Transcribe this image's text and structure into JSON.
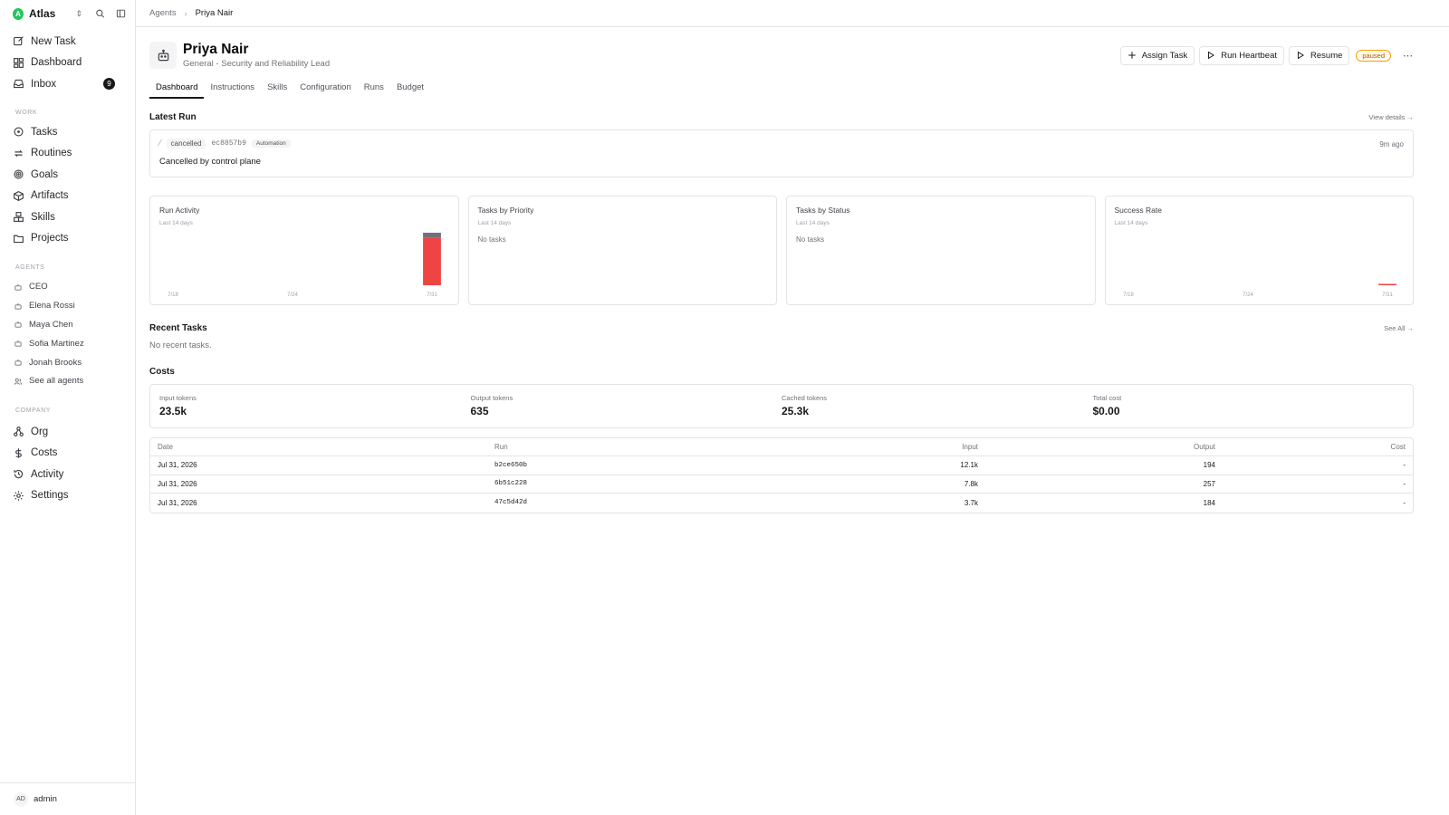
{
  "workspace": {
    "logo_letter": "A",
    "name": "Atlas"
  },
  "sidebar": {
    "top_items": [
      {
        "label": "New Task",
        "icon": "edit-icon"
      },
      {
        "label": "Dashboard",
        "icon": "dashboard-icon"
      },
      {
        "label": "Inbox",
        "icon": "inbox-icon",
        "badge": "9"
      }
    ],
    "work_label": "WORK",
    "work_items": [
      {
        "label": "Tasks",
        "icon": "circle-icon"
      },
      {
        "label": "Routines",
        "icon": "repeat-icon"
      },
      {
        "label": "Goals",
        "icon": "target-icon"
      },
      {
        "label": "Artifacts",
        "icon": "package-icon"
      },
      {
        "label": "Skills",
        "icon": "boxes-icon"
      },
      {
        "label": "Projects",
        "icon": "folder-icon"
      }
    ],
    "agents_label": "AGENTS",
    "agents": [
      {
        "label": "CEO"
      },
      {
        "label": "Elena Rossi"
      },
      {
        "label": "Maya Chen"
      },
      {
        "label": "Sofia Martinez"
      },
      {
        "label": "Jonah Brooks"
      }
    ],
    "see_all_agents": "See all agents",
    "company_label": "COMPANY",
    "company_items": [
      {
        "label": "Org",
        "icon": "org-icon"
      },
      {
        "label": "Costs",
        "icon": "dollar-icon"
      },
      {
        "label": "Activity",
        "icon": "history-icon"
      },
      {
        "label": "Settings",
        "icon": "gear-icon"
      }
    ],
    "footer": {
      "initials": "AD",
      "name": "admin"
    }
  },
  "breadcrumb": {
    "parent": "Agents",
    "current": "Priya Nair"
  },
  "agent": {
    "name": "Priya Nair",
    "subtitle": "General - Security and Reliability Lead",
    "status": "paused"
  },
  "actions": {
    "assign": "Assign Task",
    "heartbeat": "Run Heartbeat",
    "resume": "Resume"
  },
  "tabs": [
    "Dashboard",
    "Instructions",
    "Skills",
    "Configuration",
    "Runs",
    "Budget"
  ],
  "latest_run": {
    "title": "Latest Run",
    "link": "View details →",
    "status": "cancelled",
    "run_id": "ec8857b9",
    "tag": "Automation",
    "time": "9m ago",
    "message": "Cancelled by control plane"
  },
  "charts": {
    "run_activity": {
      "title": "Run Activity",
      "sub": "Last 14 days",
      "x_labels": [
        "7/18",
        "7/24",
        "7/31"
      ]
    },
    "priority": {
      "title": "Tasks by Priority",
      "sub": "Last 14 days",
      "empty": "No tasks"
    },
    "status": {
      "title": "Tasks by Status",
      "sub": "Last 14 days",
      "empty": "No tasks"
    },
    "success": {
      "title": "Success Rate",
      "sub": "Last 14 days",
      "x_labels": [
        "7/18",
        "7/24",
        "7/31"
      ]
    }
  },
  "chart_data": [
    {
      "type": "bar",
      "title": "Run Activity",
      "categories": [
        "7/18",
        "7/19",
        "7/20",
        "7/21",
        "7/22",
        "7/23",
        "7/24",
        "7/25",
        "7/26",
        "7/27",
        "7/28",
        "7/29",
        "7/30",
        "7/31"
      ],
      "series": [
        {
          "values": [
            0,
            0,
            0,
            0,
            0,
            0,
            0,
            0,
            0,
            0,
            0,
            0,
            0,
            9
          ],
          "color": "#ef4444"
        },
        {
          "values": [
            0,
            0,
            0,
            0,
            0,
            0,
            0,
            0,
            0,
            0,
            0,
            0,
            0,
            1
          ],
          "color": "#71717a"
        }
      ],
      "stacked": true,
      "x_tick_labels": [
        "7/18",
        "7/24",
        "7/31"
      ]
    },
    {
      "type": "bar",
      "title": "Success Rate",
      "categories": [
        "7/18",
        "7/19",
        "7/20",
        "7/21",
        "7/22",
        "7/23",
        "7/24",
        "7/25",
        "7/26",
        "7/27",
        "7/28",
        "7/29",
        "7/30",
        "7/31"
      ],
      "series": [
        {
          "values": [
            null,
            null,
            null,
            null,
            null,
            null,
            null,
            null,
            null,
            null,
            null,
            null,
            null,
            0
          ],
          "color": "#ef4444"
        }
      ],
      "x_tick_labels": [
        "7/18",
        "7/24",
        "7/31"
      ]
    }
  ],
  "recent_tasks": {
    "title": "Recent Tasks",
    "link": "See All →",
    "empty": "No recent tasks."
  },
  "costs": {
    "title": "Costs",
    "summary": [
      {
        "label": "Input tokens",
        "value": "23.5k"
      },
      {
        "label": "Output tokens",
        "value": "635"
      },
      {
        "label": "Cached tokens",
        "value": "25.3k"
      },
      {
        "label": "Total cost",
        "value": "$0.00"
      }
    ],
    "columns": [
      "Date",
      "Run",
      "Input",
      "Output",
      "Cost"
    ],
    "rows": [
      {
        "date": "Jul 31, 2026",
        "run": "b2ce650b",
        "input": "12.1k",
        "output": "194",
        "cost": "-"
      },
      {
        "date": "Jul 31, 2026",
        "run": "6b51c228",
        "input": "7.8k",
        "output": "257",
        "cost": "-"
      },
      {
        "date": "Jul 31, 2026",
        "run": "47c5d42d",
        "input": "3.7k",
        "output": "184",
        "cost": "-"
      }
    ]
  }
}
